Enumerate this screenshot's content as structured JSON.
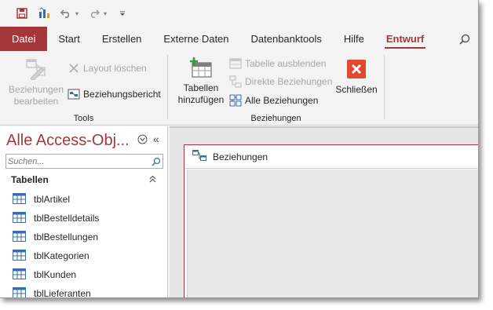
{
  "qat": {
    "save_icon": "save-icon",
    "customize_icon": "property-sheet-icon",
    "undo_icon": "undo-icon",
    "redo_icon": "redo-icon"
  },
  "tabs": [
    "Datei",
    "Start",
    "Erstellen",
    "Externe Daten",
    "Datenbanktools",
    "Hilfe",
    "Entwurf"
  ],
  "ribbon": {
    "tools": {
      "label": "Tools",
      "edit_relationships": "Beziehungen bearbeiten",
      "clear_layout": "Layout löschen",
      "relationship_report": "Beziehungsbericht"
    },
    "relationships": {
      "label": "Beziehungen",
      "add_tables": "Tabellen hinzufügen",
      "hide_table": "Tabelle ausblenden",
      "direct_relationships": "Direkte Beziehungen",
      "all_relationships": "Alle Beziehungen",
      "close": "Schließen"
    }
  },
  "nav": {
    "title": "Alle Access-Obj...",
    "search_placeholder": "Suchen...",
    "category": "Tabellen",
    "items": [
      "tblArtikel",
      "tblBestelldetails",
      "tblBestellungen",
      "tblKategorien",
      "tblKunden",
      "tblLieferanten"
    ]
  },
  "document": {
    "tab_label": "Beziehungen"
  },
  "colors": {
    "accent": "#a4373a",
    "close_button": "#e04a2f",
    "ribbon_bg": "#f3f3f3"
  }
}
